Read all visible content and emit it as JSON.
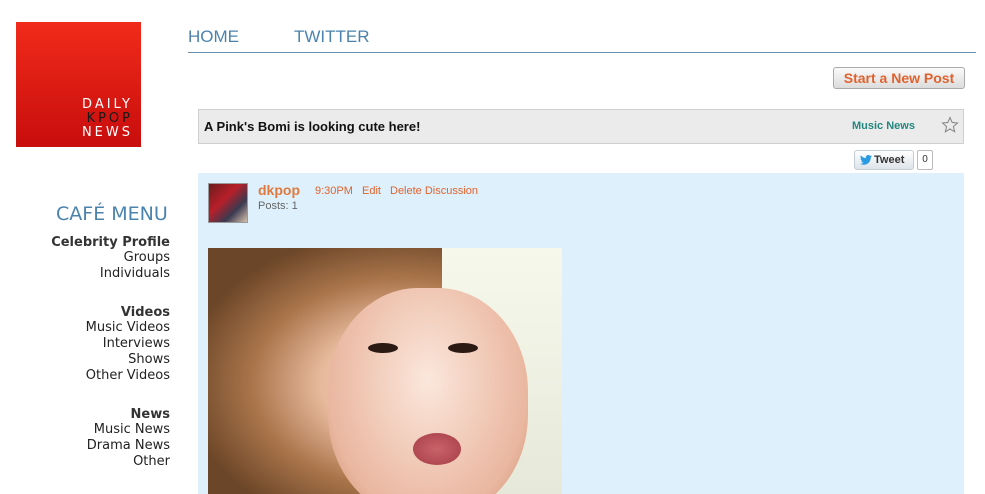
{
  "logo": {
    "line1": "DAILY",
    "line2": "KPOP",
    "line3": "NEWS"
  },
  "nav": {
    "home": "HOME",
    "twitter": "TWITTER"
  },
  "actions": {
    "new_post": "Start a New Post"
  },
  "thread": {
    "title": "A Pink's Bomi is looking cute here!",
    "category": "Music News",
    "tweet_label": "Tweet",
    "tweet_count": "0"
  },
  "post": {
    "author": "dkpop",
    "time": "9:30PM",
    "edit": "Edit",
    "delete": "Delete Discussion",
    "posts": "Posts: 1"
  },
  "menu": {
    "title": "CAFÉ MENU",
    "sections": [
      {
        "heading": "Celebrity Profile",
        "items": [
          "Groups",
          "Individuals"
        ]
      },
      {
        "heading": "Videos",
        "items": [
          "Music Videos",
          "Interviews",
          "Shows",
          "Other Videos"
        ]
      },
      {
        "heading": "News",
        "items": [
          "Music News",
          "Drama News",
          "Other"
        ]
      }
    ]
  },
  "colors": {
    "accent": "#4c83ad",
    "link_orange": "#e0632e",
    "category": "#23877f",
    "post_bg": "#def0fb"
  }
}
